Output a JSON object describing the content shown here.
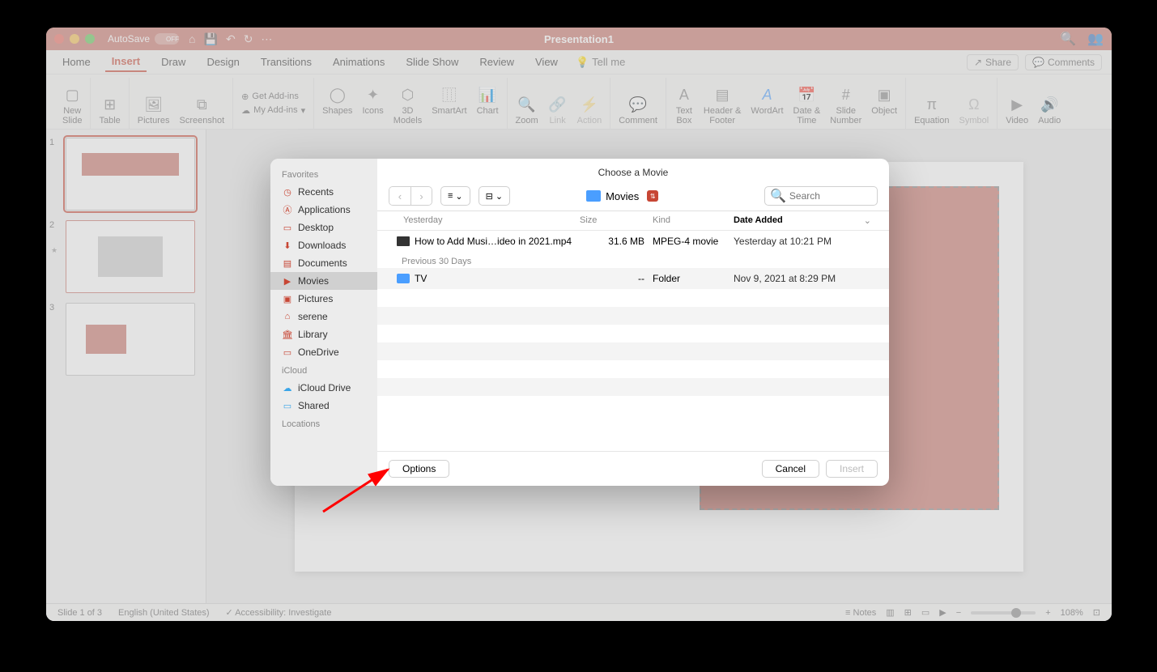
{
  "titlebar": {
    "autosave_label": "AutoSave",
    "autosave_state": "OFF",
    "title": "Presentation1"
  },
  "menubar": {
    "items": [
      {
        "label": "Home"
      },
      {
        "label": "Insert",
        "active": true
      },
      {
        "label": "Draw"
      },
      {
        "label": "Design"
      },
      {
        "label": "Transitions"
      },
      {
        "label": "Animations"
      },
      {
        "label": "Slide Show"
      },
      {
        "label": "Review"
      },
      {
        "label": "View"
      }
    ],
    "tellme": "Tell me",
    "share": "Share",
    "comments": "Comments"
  },
  "ribbon": {
    "new_slide": "New\nSlide",
    "table": "Table",
    "pictures": "Pictures",
    "screenshot": "Screenshot",
    "get_addins": "Get Add-ins",
    "my_addins": "My Add-ins",
    "shapes": "Shapes",
    "icons": "Icons",
    "models": "3D\nModels",
    "smartart": "SmartArt",
    "chart": "Chart",
    "zoom": "Zoom",
    "link": "Link",
    "action": "Action",
    "comment": "Comment",
    "textbox": "Text\nBox",
    "headerfooter": "Header &\nFooter",
    "wordart": "WordArt",
    "datetime": "Date &\nTime",
    "slidenumber": "Slide\nNumber",
    "object": "Object",
    "equation": "Equation",
    "symbol": "Symbol",
    "video": "Video",
    "audio": "Audio"
  },
  "slides": {
    "count": 3,
    "selected": 1
  },
  "dialog": {
    "title": "Choose a Movie",
    "location": "Movies",
    "search_placeholder": "Search",
    "sidebar": {
      "favorites": "Favorites",
      "items": [
        {
          "label": "Recents",
          "icon": "clock",
          "color": "#c74634"
        },
        {
          "label": "Applications",
          "icon": "A",
          "color": "#c74634"
        },
        {
          "label": "Desktop",
          "icon": "desktop",
          "color": "#c74634"
        },
        {
          "label": "Downloads",
          "icon": "download",
          "color": "#c74634"
        },
        {
          "label": "Documents",
          "icon": "doc",
          "color": "#c74634"
        },
        {
          "label": "Movies",
          "icon": "movie",
          "selected": true,
          "color": "#c74634"
        },
        {
          "label": "Pictures",
          "icon": "pic",
          "color": "#c74634"
        },
        {
          "label": "serene",
          "icon": "home",
          "color": "#c74634"
        },
        {
          "label": "Library",
          "icon": "library",
          "color": "#c74634"
        },
        {
          "label": "OneDrive",
          "icon": "folder",
          "color": "#c74634"
        }
      ],
      "icloud": "iCloud",
      "icloud_items": [
        {
          "label": "iCloud Drive",
          "icon": "cloud",
          "color": "#3aa5e8"
        },
        {
          "label": "Shared",
          "icon": "sharedfolder",
          "color": "#3aa5e8"
        }
      ],
      "locations": "Locations"
    },
    "columns": {
      "section_yesterday": "Yesterday",
      "size": "Size",
      "kind": "Kind",
      "date": "Date Added",
      "section_prev30": "Previous 30 Days"
    },
    "rows": [
      {
        "name": "How to Add Musi…ideo in 2021.mp4",
        "size": "31.6 MB",
        "kind": "MPEG-4 movie",
        "date": "Yesterday at 10:21 PM",
        "type": "file"
      },
      {
        "name": "TV",
        "size": "--",
        "kind": "Folder",
        "date": "Nov 9, 2021 at 8:29 PM",
        "type": "folder"
      }
    ],
    "buttons": {
      "options": "Options",
      "cancel": "Cancel",
      "insert": "Insert"
    }
  },
  "statusbar": {
    "slide": "Slide 1 of 3",
    "lang": "English (United States)",
    "accessibility": "Accessibility: Investigate",
    "notes": "Notes",
    "zoom": "108%"
  }
}
